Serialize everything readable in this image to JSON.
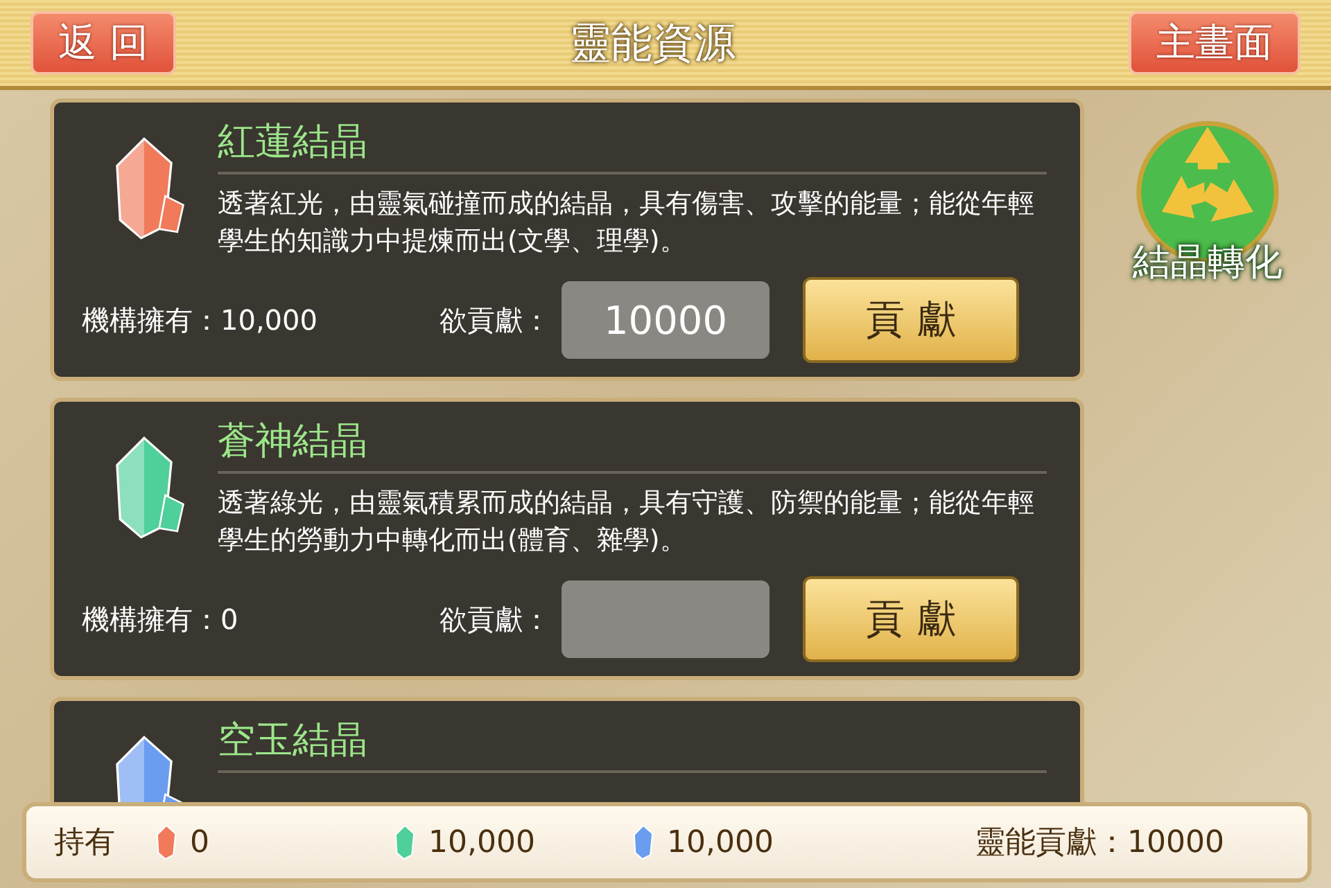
{
  "header": {
    "back_button": "返 回",
    "title": "靈能資源",
    "home_button": "主畫面"
  },
  "crystals": [
    {
      "name": "紅蓮結晶",
      "color": "#f07a5a",
      "description": "透著紅光，由靈氣碰撞而成的結晶，具有傷害、攻擊的能量；能從年輕學生的知識力中提煉而出(文學、理學)。",
      "owned": "機構擁有：10,000",
      "contribute_label": "欲貢獻：",
      "contribute_value": "10000",
      "button": "貢 獻"
    },
    {
      "name": "蒼神結晶",
      "color": "#4fcf9a",
      "description": "透著綠光，由靈氣積累而成的結晶，具有守護、防禦的能量；能從年輕學生的勞動力中轉化而出(體育、雜學)。",
      "owned": "機構擁有：0",
      "contribute_label": "欲貢獻：",
      "button": "貢 獻"
    },
    {
      "name": "空玉結晶",
      "color": "#6a9cf0"
    }
  ],
  "convert_button": "結晶轉化",
  "footer": {
    "label": "持有",
    "holdings": [
      {
        "color": "#f07a5a",
        "amount": "0"
      },
      {
        "color": "#4fcf9a",
        "amount": "10,000"
      },
      {
        "color": "#6a9cf0",
        "amount": "10,000"
      }
    ],
    "contribution": "靈能貢獻：10000"
  }
}
